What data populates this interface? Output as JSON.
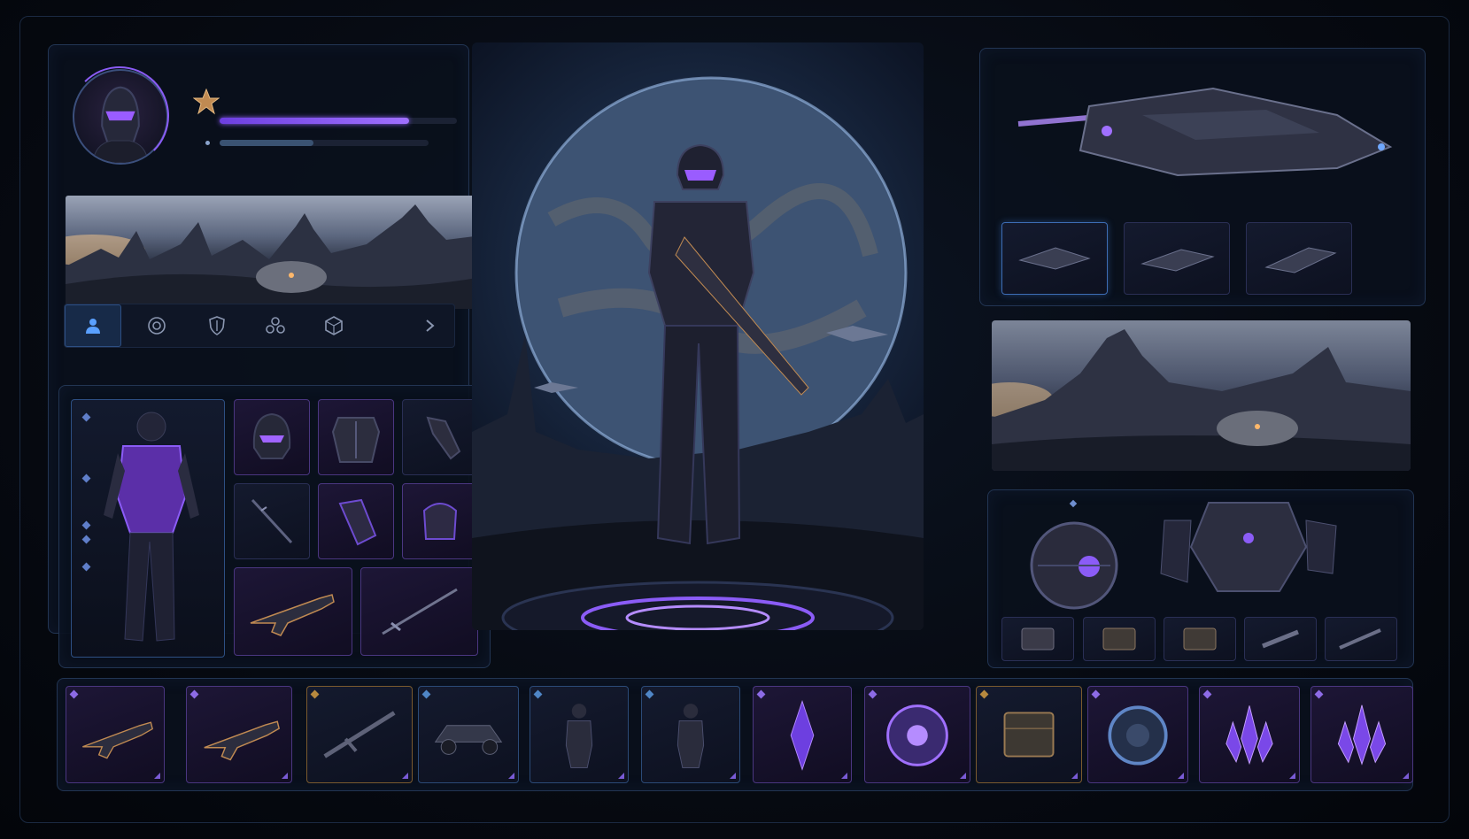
{
  "player": {
    "avatar_icon": "soldier-helmet-icon",
    "rank_icon": "rank-star-icon",
    "xp_progress": 0.8,
    "energy_progress": 0.45
  },
  "colors": {
    "accent_purple": "#8b5cf6",
    "accent_blue": "#3d6db5",
    "panel_border": "#223553",
    "bar_secondary": "#3a5272"
  },
  "tabs": [
    {
      "id": "profile",
      "icon": "user-icon",
      "active": true
    },
    {
      "id": "target",
      "icon": "target-icon",
      "active": false
    },
    {
      "id": "shield",
      "icon": "shield-icon",
      "active": false
    },
    {
      "id": "squad",
      "icon": "squad-icon",
      "active": false
    },
    {
      "id": "module",
      "icon": "cube-icon",
      "active": false
    },
    {
      "id": "next",
      "icon": "chevron-right-icon",
      "active": false
    }
  ],
  "equipment": {
    "slots": [
      "helmet-icon",
      "chest-armor-icon",
      "gauntlet-icon",
      "blade-icon",
      "arm-guard-icon",
      "shoulder-armor-icon",
      "rifle-icon",
      "sword-icon"
    ]
  },
  "ships": {
    "selected": 0,
    "thumbs": [
      "ship-icon",
      "ship-icon",
      "ship-icon"
    ]
  },
  "drones": {
    "items": [
      "drone-sphere-icon",
      "mech-icon"
    ],
    "loot": [
      "crate-icon",
      "crate-icon",
      "crate-icon",
      "cannon-icon",
      "rifle-icon"
    ]
  },
  "inventory": [
    {
      "icon": "rifle-icon",
      "rarity": "purple"
    },
    {
      "icon": "rifle-icon",
      "rarity": "purple"
    },
    {
      "icon": "sniper-rifle-icon",
      "rarity": "orange"
    },
    {
      "icon": "buggy-icon",
      "rarity": "blue"
    },
    {
      "icon": "soldier-icon",
      "rarity": "blue"
    },
    {
      "icon": "soldier-icon",
      "rarity": "blue"
    },
    {
      "icon": "crystal-icon",
      "rarity": "purple"
    },
    {
      "icon": "energy-orb-icon",
      "rarity": "purple"
    },
    {
      "icon": "crate-icon",
      "rarity": "orange"
    },
    {
      "icon": "core-orb-icon",
      "rarity": "purple"
    },
    {
      "icon": "crystal-cluster-icon",
      "rarity": "purple"
    },
    {
      "icon": "crystal-cluster-icon",
      "rarity": "purple"
    }
  ]
}
